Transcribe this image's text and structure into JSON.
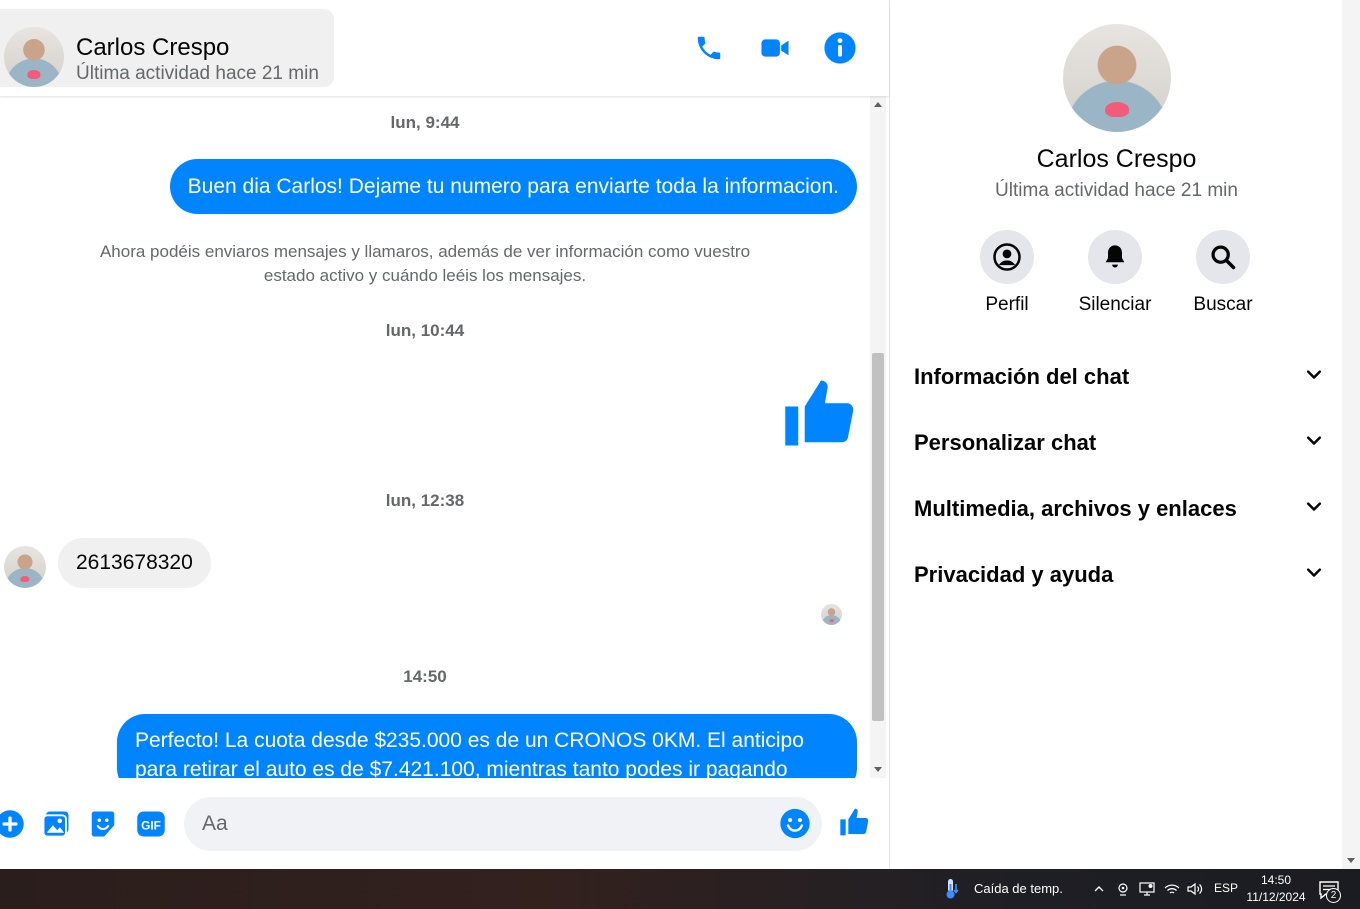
{
  "header": {
    "name": "Carlos Crespo",
    "status": "Última actividad hace 21 min"
  },
  "icons": {
    "call": "phone-icon",
    "video": "video-camera-icon",
    "info": "info-icon",
    "add": "plus-circle-icon",
    "gallery": "image-icon",
    "sticker": "sticker-icon",
    "gif": "gif-icon",
    "emoji": "emoji-icon",
    "like": "thumbs-up-icon"
  },
  "accent_color": "#0084ff",
  "messages": {
    "ts1": "lun, 9:44",
    "out1": "Buen dia Carlos! Dejame tu numero para enviarte toda la informacion.",
    "system": "Ahora podéis enviaros mensajes y llamaros, además de ver información como vuestro estado activo y cuándo leéis los mensajes.",
    "ts2": "lun, 10:44",
    "ts3": "lun, 12:38",
    "in1": "2613678320",
    "ts4": "14:50",
    "out2_line1": "Perfecto! La cuota desde $235.000 es de un CRONOS 0KM. El anticipo",
    "out2_line2": "para retirar el auto es de $7.421.100, mientras tanto podes ir pagando"
  },
  "composer": {
    "gif_label": "GIF",
    "placeholder": "Aa"
  },
  "side": {
    "name": "Carlos Crespo",
    "status": "Última actividad hace 21 min",
    "actions": [
      {
        "label": "Perfil"
      },
      {
        "label": "Silenciar"
      },
      {
        "label": "Buscar"
      }
    ],
    "sections": [
      {
        "title": "Información del chat"
      },
      {
        "title": "Personalizar chat"
      },
      {
        "title": "Multimedia, archivos y enlaces"
      },
      {
        "title": "Privacidad y ayuda"
      }
    ]
  },
  "taskbar": {
    "weather": "Caída de temp.",
    "language": "ESP",
    "time": "14:50",
    "date": "11/12/2024",
    "notifications": "2"
  }
}
